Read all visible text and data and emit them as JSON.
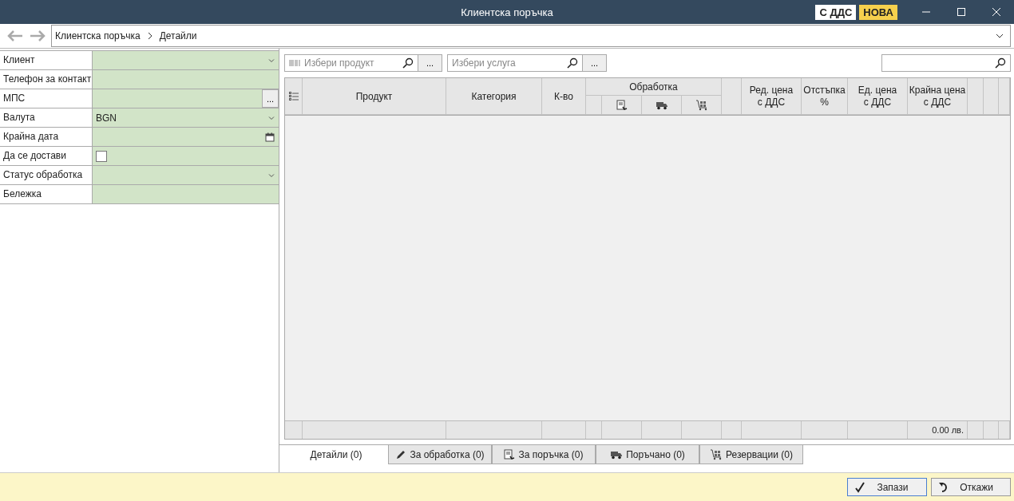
{
  "window": {
    "title": "Клиентска поръчка",
    "badges": [
      {
        "label": "С ДДС",
        "kind": "plain"
      },
      {
        "label": "НОВА",
        "kind": "status"
      }
    ]
  },
  "nav": {
    "breadcrumb": [
      "Клиентска поръчка",
      "Детайли"
    ]
  },
  "form": [
    {
      "label": "Клиент",
      "kind": "select"
    },
    {
      "label": "Телефон за контакт",
      "kind": "text"
    },
    {
      "label": "МПС",
      "kind": "browse",
      "button": "..."
    },
    {
      "label": "Валута",
      "kind": "select",
      "value": "BGN"
    },
    {
      "label": "Крайна дата",
      "kind": "date"
    },
    {
      "label": "Да се достави",
      "kind": "checkbox",
      "checked": false
    },
    {
      "label": "Статус обработка",
      "kind": "select"
    },
    {
      "label": "Бележка",
      "kind": "text"
    }
  ],
  "toolbar": {
    "product": {
      "placeholder": "Избери продукт",
      "button": "..."
    },
    "service": {
      "placeholder": "Избери услуга",
      "button": "..."
    }
  },
  "table": {
    "columns": {
      "product": "Продукт",
      "category": "Категория",
      "qty": "К-во",
      "processing": "Обработка",
      "list_price": [
        "Ред. цена",
        "с ДДС"
      ],
      "discount": [
        "Отстъпка",
        "%"
      ],
      "unit_price": [
        "Ед. цена",
        "с ДДС"
      ],
      "total_price": [
        "Крайна цена",
        "с ДДС"
      ]
    },
    "footer_total": "0.00 лв."
  },
  "tabs": [
    {
      "label": "Детайли (0)",
      "kind": "details",
      "selected": true
    },
    {
      "label": "За обработка (0)",
      "kind": "processing",
      "selected": false
    },
    {
      "label": "За поръчка (0)",
      "kind": "to_order",
      "selected": false
    },
    {
      "label": "Поръчано (0)",
      "kind": "ordered",
      "selected": false
    },
    {
      "label": "Резервации (0)",
      "kind": "reservations",
      "selected": false
    }
  ],
  "buttons": [
    {
      "label": "Запази",
      "kind": "save"
    },
    {
      "label": "Откажи",
      "kind": "cancel"
    }
  ]
}
